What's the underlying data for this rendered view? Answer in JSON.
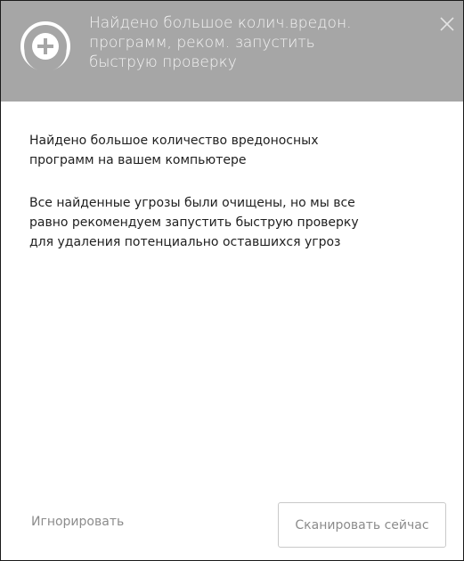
{
  "header": {
    "title": "Найдено большое колич.вредон.\nпрограмм, реком. запустить\nбыструю проверку",
    "background_color": "#a6a6a6",
    "logo_icon": "refresh-plus-icon",
    "close_icon": "close-icon"
  },
  "body": {
    "paragraph_1": "Найдено большое количество вредоносных\nпрограмм на вашем компьютере",
    "paragraph_2": "Все найденные угрозы были очищены, но мы все\nравно рекомендуем запустить быструю проверку\nдля удаления потенциально оставшихся угроз"
  },
  "footer": {
    "ignore_label": "Игнорировать",
    "scan_label": "Сканировать сейчас"
  }
}
